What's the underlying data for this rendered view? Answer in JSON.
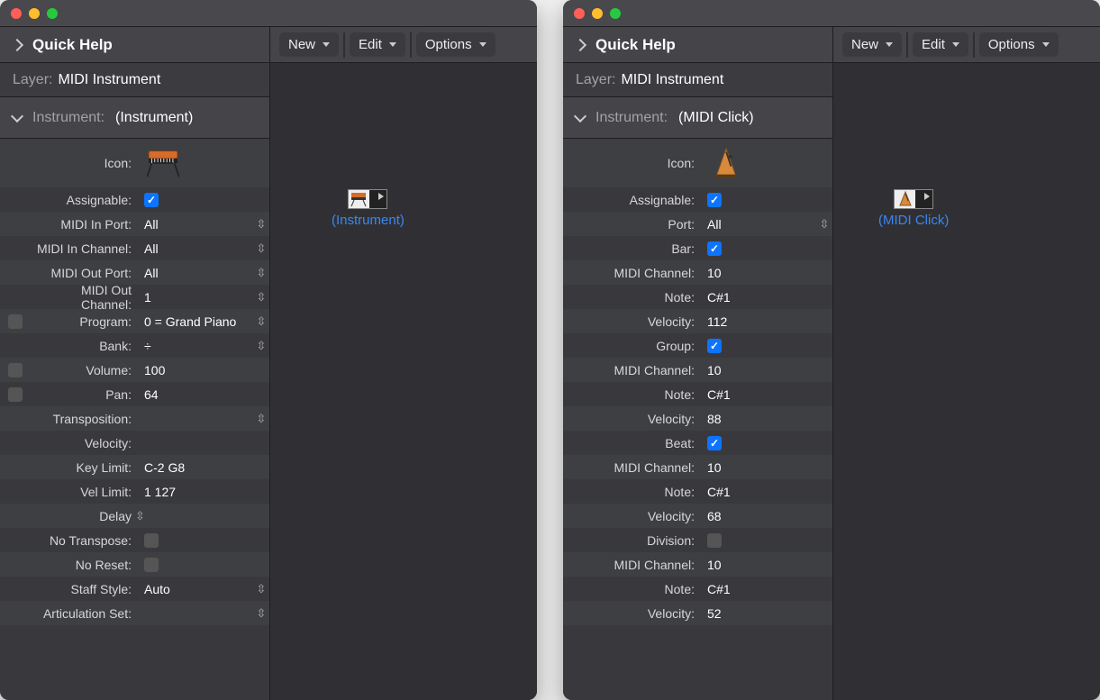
{
  "leftWindow": {
    "quickHelp": "Quick Help",
    "layerLabel": "Layer:",
    "layerValue": "MIDI Instrument",
    "instrumentLabel": "Instrument:",
    "instrumentValue": "(Instrument)",
    "toolbar": {
      "new": "New",
      "edit": "Edit",
      "options": "Options"
    },
    "canvasObject": "(Instrument)",
    "props": {
      "iconLabel": "Icon:",
      "assignableLabel": "Assignable:",
      "midiInPortLabel": "MIDI In Port:",
      "midiInPortValue": "All",
      "midiInChanLabel": "MIDI In Channel:",
      "midiInChanValue": "All",
      "midiOutPortLabel": "MIDI Out Port:",
      "midiOutPortValue": "All",
      "midiOutChanLabel": "MIDI Out Channel:",
      "midiOutChanValue": "1",
      "programLabel": "Program:",
      "programValue": "0 = Grand Piano",
      "bankLabel": "Bank:",
      "bankValue": "÷",
      "volumeLabel": "Volume:",
      "volumeValue": "100",
      "panLabel": "Pan:",
      "panValue": "64",
      "transLabel": "Transposition:",
      "velLabel": "Velocity:",
      "keyLimLabel": "Key Limit:",
      "keyLimValue": "C-2  G8",
      "velLimLabel": "Vel Limit:",
      "velLimValue": "1  127",
      "delayLabel": "Delay",
      "noTransLabel": "No Transpose:",
      "noResetLabel": "No Reset:",
      "staffLabel": "Staff Style:",
      "staffValue": "Auto",
      "artLabel": "Articulation Set:"
    }
  },
  "rightWindow": {
    "quickHelp": "Quick Help",
    "layerLabel": "Layer:",
    "layerValue": "MIDI Instrument",
    "instrumentLabel": "Instrument:",
    "instrumentValue": "(MIDI Click)",
    "toolbar": {
      "new": "New",
      "edit": "Edit",
      "options": "Options"
    },
    "canvasObject": "(MIDI Click)",
    "props": {
      "iconLabel": "Icon:",
      "assignableLabel": "Assignable:",
      "portLabel": "Port:",
      "portValue": "All",
      "barLabel": "Bar:",
      "midiCh1Label": "MIDI Channel:",
      "midiCh1Value": "10",
      "note1Label": "Note:",
      "note1Value": "C#1",
      "vel1Label": "Velocity:",
      "vel1Value": "112",
      "groupLabel": "Group:",
      "midiCh2Label": "MIDI Channel:",
      "midiCh2Value": "10",
      "note2Label": "Note:",
      "note2Value": "C#1",
      "vel2Label": "Velocity:",
      "vel2Value": "88",
      "beatLabel": "Beat:",
      "midiCh3Label": "MIDI Channel:",
      "midiCh3Value": "10",
      "note3Label": "Note:",
      "note3Value": "C#1",
      "vel3Label": "Velocity:",
      "vel3Value": "68",
      "divLabel": "Division:",
      "midiCh4Label": "MIDI Channel:",
      "midiCh4Value": "10",
      "note4Label": "Note:",
      "note4Value": "C#1",
      "vel4Label": "Velocity:",
      "vel4Value": "52"
    }
  }
}
